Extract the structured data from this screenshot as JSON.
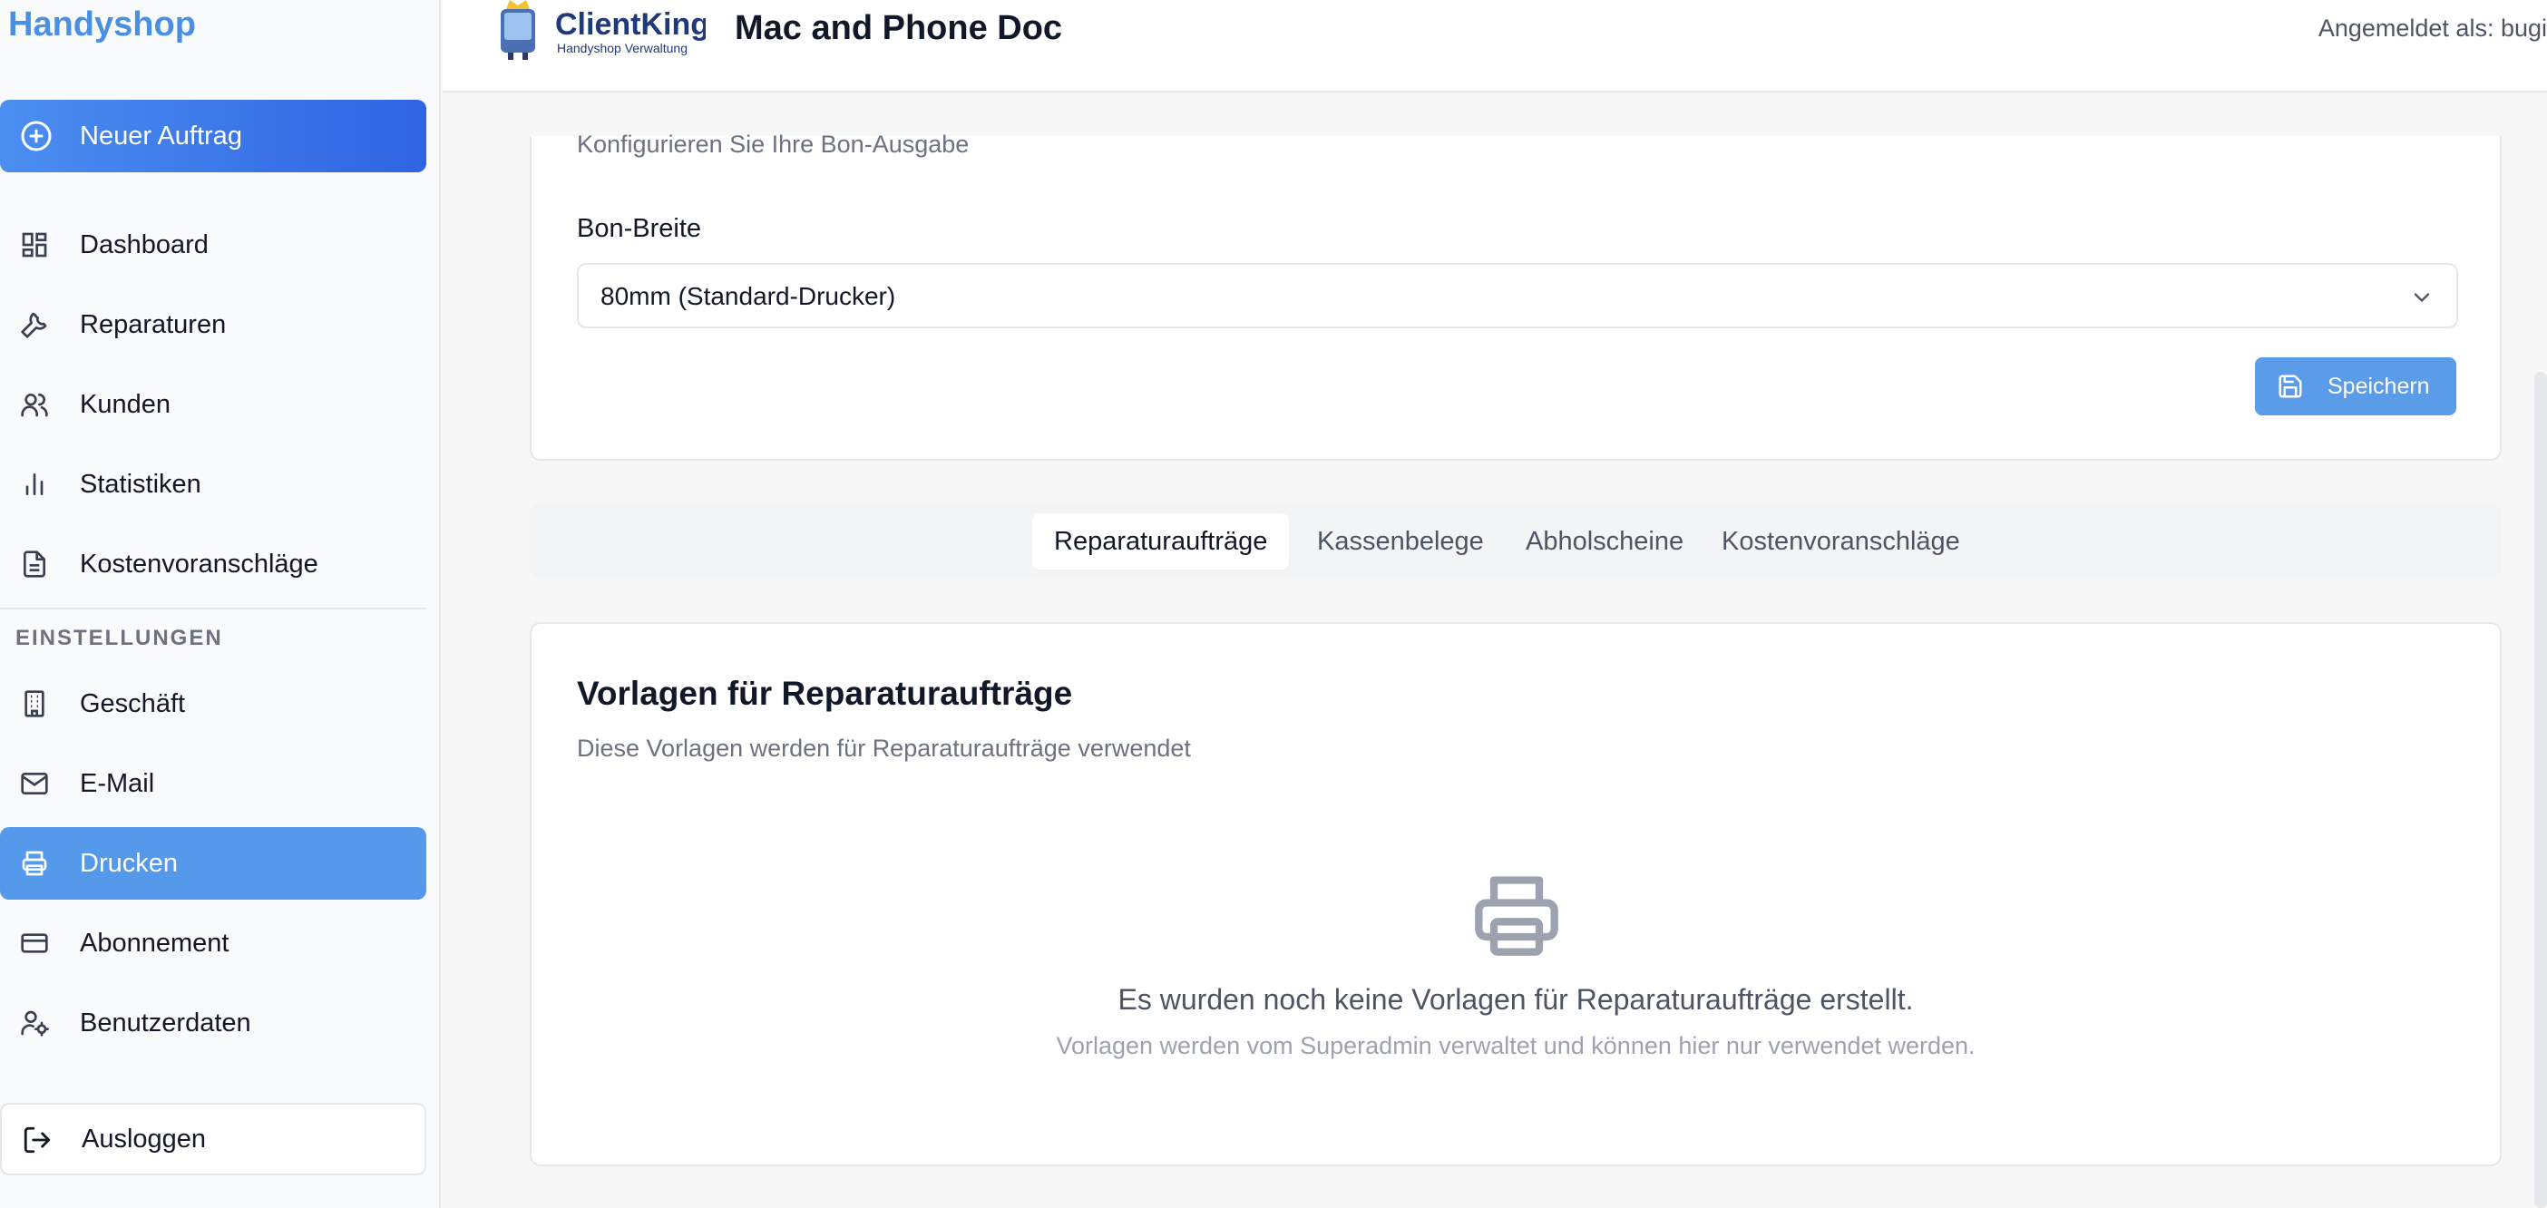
{
  "sidebar": {
    "brand": "Handyshop",
    "new_order": "Neuer Auftrag",
    "items": [
      {
        "label": "Dashboard",
        "icon": "dashboard-icon"
      },
      {
        "label": "Reparaturen",
        "icon": "wrench-icon"
      },
      {
        "label": "Kunden",
        "icon": "users-icon"
      },
      {
        "label": "Statistiken",
        "icon": "bar-chart-icon"
      },
      {
        "label": "Kostenvoranschläge",
        "icon": "document-icon"
      }
    ],
    "section_label": "EINSTELLUNGEN",
    "settings_items": [
      {
        "label": "Geschäft",
        "icon": "building-icon"
      },
      {
        "label": "E-Mail",
        "icon": "mail-icon"
      },
      {
        "label": "Drucken",
        "icon": "printer-icon",
        "active": true
      },
      {
        "label": "Abonnement",
        "icon": "credit-card-icon"
      },
      {
        "label": "Benutzerdaten",
        "icon": "user-cog-icon"
      }
    ],
    "logout": "Ausloggen"
  },
  "header": {
    "logo_name": "ClientKing",
    "logo_tagline": "Handyshop Verwaltung",
    "shop_title": "Mac and Phone Doc",
    "logged_in": "Angemeldet als: bugi"
  },
  "receipt_settings": {
    "description": "Konfigurieren Sie Ihre Bon-Ausgabe",
    "width_label": "Bon-Breite",
    "width_value": "80mm (Standard-Drucker)",
    "save_label": "Speichern"
  },
  "tabs": [
    {
      "label": "Reparaturaufträge",
      "active": true
    },
    {
      "label": "Kassenbelege"
    },
    {
      "label": "Abholscheine"
    },
    {
      "label": "Kostenvoranschläge"
    }
  ],
  "templates": {
    "title": "Vorlagen für Reparaturaufträge",
    "subtitle": "Diese Vorlagen werden für Reparaturaufträge verwendet",
    "empty_title": "Es wurden noch keine Vorlagen für Reparaturaufträge erstellt.",
    "empty_subtitle": "Vorlagen werden vom Superadmin verwaltet und können hier nur verwendet werden."
  },
  "colors": {
    "brand": "#4a90e2",
    "primary_gradient_start": "#4b8ff0",
    "primary_gradient_end": "#2f63e2",
    "active_nav": "#5599ea",
    "save_button": "#5b9ce8"
  }
}
